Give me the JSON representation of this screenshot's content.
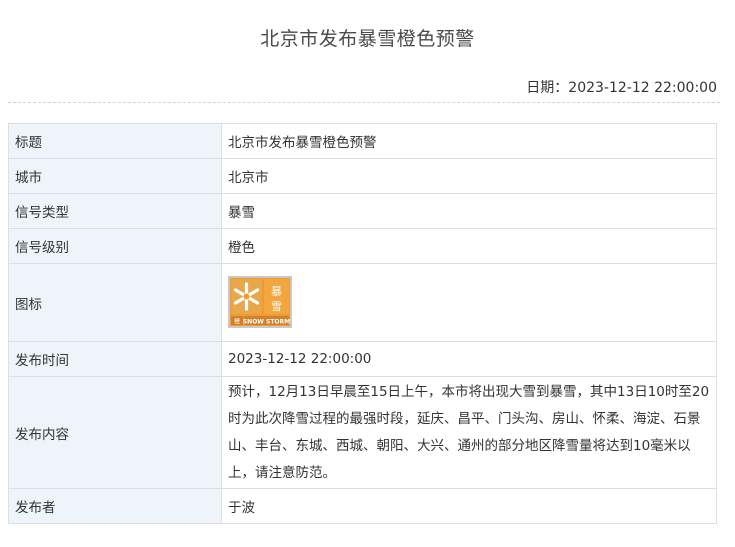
{
  "page": {
    "title": "北京市发布暴雪橙色预警",
    "date_label": "日期：2023-12-12 22:00:00"
  },
  "table": {
    "rows": [
      {
        "label": "标题",
        "value": "北京市发布暴雪橙色预警"
      },
      {
        "label": "城市",
        "value": "北京市"
      },
      {
        "label": "信号类型",
        "value": "暴雪"
      },
      {
        "label": "信号级别",
        "value": "橙色"
      },
      {
        "label": "图标",
        "icon": {
          "name": "snowstorm-orange-warning-icon",
          "text_cn": "暴雪",
          "text_en": "SNOW STORM",
          "text_level": "橙色",
          "color": "#f29a2e"
        }
      },
      {
        "label": "发布时间",
        "value": "2023-12-12 22:00:00"
      },
      {
        "label": "发布内容",
        "value": "预计，12月13日早晨至15日上午，本市将出现大雪到暴雪，其中13日10时至20时为此次降雪过程的最强时段，延庆、昌平、门头沟、房山、怀柔、海淀、石景山、丰台、东城、西城、朝阳、大兴、通州的部分地区降雪量将达到10毫米以上，请注意防范。"
      },
      {
        "label": "发布者",
        "value": "于波"
      }
    ]
  },
  "colors": {
    "label_bg": "#eef4fa",
    "border": "#d9dfe6",
    "icon_orange": "#f29a2e"
  }
}
